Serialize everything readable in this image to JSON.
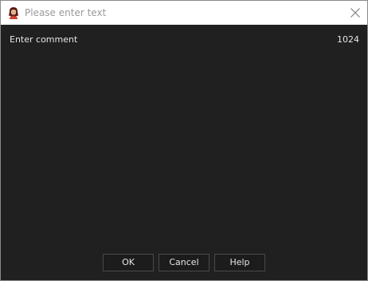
{
  "dialog": {
    "title": "Please enter text",
    "icon": "user-avatar-icon"
  },
  "field": {
    "label": "Enter comment",
    "max_length": "1024",
    "value": ""
  },
  "buttons": {
    "ok": "OK",
    "cancel": "Cancel",
    "help": "Help"
  },
  "colors": {
    "background": "#202020",
    "titlebar": "#ffffff",
    "text": "#e6e6e6"
  }
}
